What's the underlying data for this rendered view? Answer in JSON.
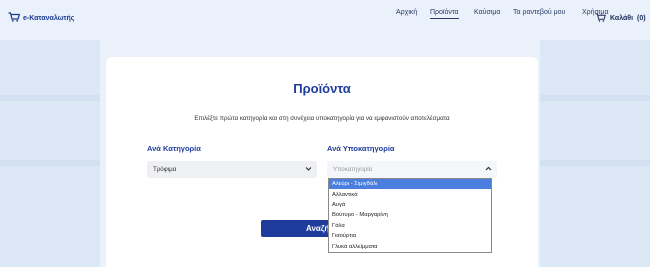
{
  "header": {
    "brand": "e-Καταναλωτής",
    "nav": [
      {
        "label": "Αρχική",
        "active": false
      },
      {
        "label": "Προϊόντα",
        "active": true
      },
      {
        "label": "Καύσιμα",
        "active": false
      },
      {
        "label": "Τα ραντεβού μου",
        "active": false
      },
      {
        "label": "Χρήσιμα",
        "active": false
      }
    ],
    "cart": {
      "label": "Καλάθι",
      "count": "(0)"
    }
  },
  "main": {
    "title": "Προϊόντα",
    "subtitle": "Επιλέξτε πρώτα κατηγορία και στη συνέχεια υποκατηγορία για να εμφανιστούν αποτελέσματα",
    "category": {
      "label": "Ανά Κατηγορία",
      "value": "Τρόφιμα"
    },
    "subcategory": {
      "label": "Ανά Υποκατηγορία",
      "placeholder": "Υποκατηγορία"
    },
    "search_label": "Αναζήτ",
    "subcategory_options": [
      "Αλεύρι - Σιμιγδάλι",
      "Αλλαντικά",
      "Αυγά",
      "Βούτυρο - Μαργαρίνη",
      "Γάλα",
      "Γιαούρτια",
      "Γλυκά αλλείμματα"
    ],
    "highlighted_option_index": 0
  },
  "colors": {
    "accent": "#1f3c9c",
    "background": "#eaf1fb",
    "highlight": "#4a7fe0"
  }
}
